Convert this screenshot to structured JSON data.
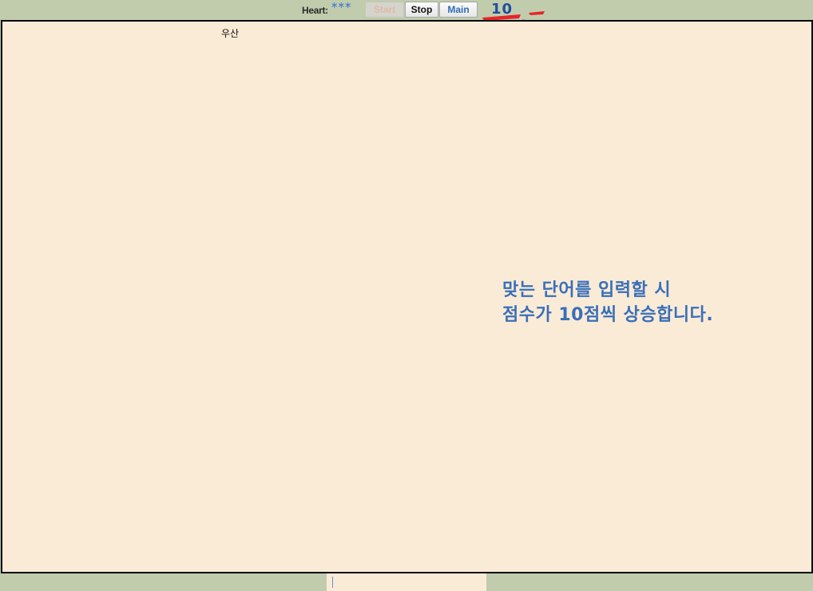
{
  "header": {
    "heart_label": "Heart:",
    "hearts": "***",
    "start_label": "Start",
    "stop_label": "Stop",
    "main_label": "Main",
    "score": "10"
  },
  "stage": {
    "falling_word": "우산",
    "hint_line1": "맞는 단어를 입력할 시",
    "hint_line2": "점수가 10점씩 상승합니다."
  },
  "input": {
    "value": "",
    "placeholder": ""
  },
  "colors": {
    "background": "#c0ccac",
    "stage": "#faebd7",
    "hint_text": "#3a6fb8",
    "score_text": "#1f4e9e",
    "hearts": "#2f6fd6",
    "ribbon": "#e8232a"
  }
}
